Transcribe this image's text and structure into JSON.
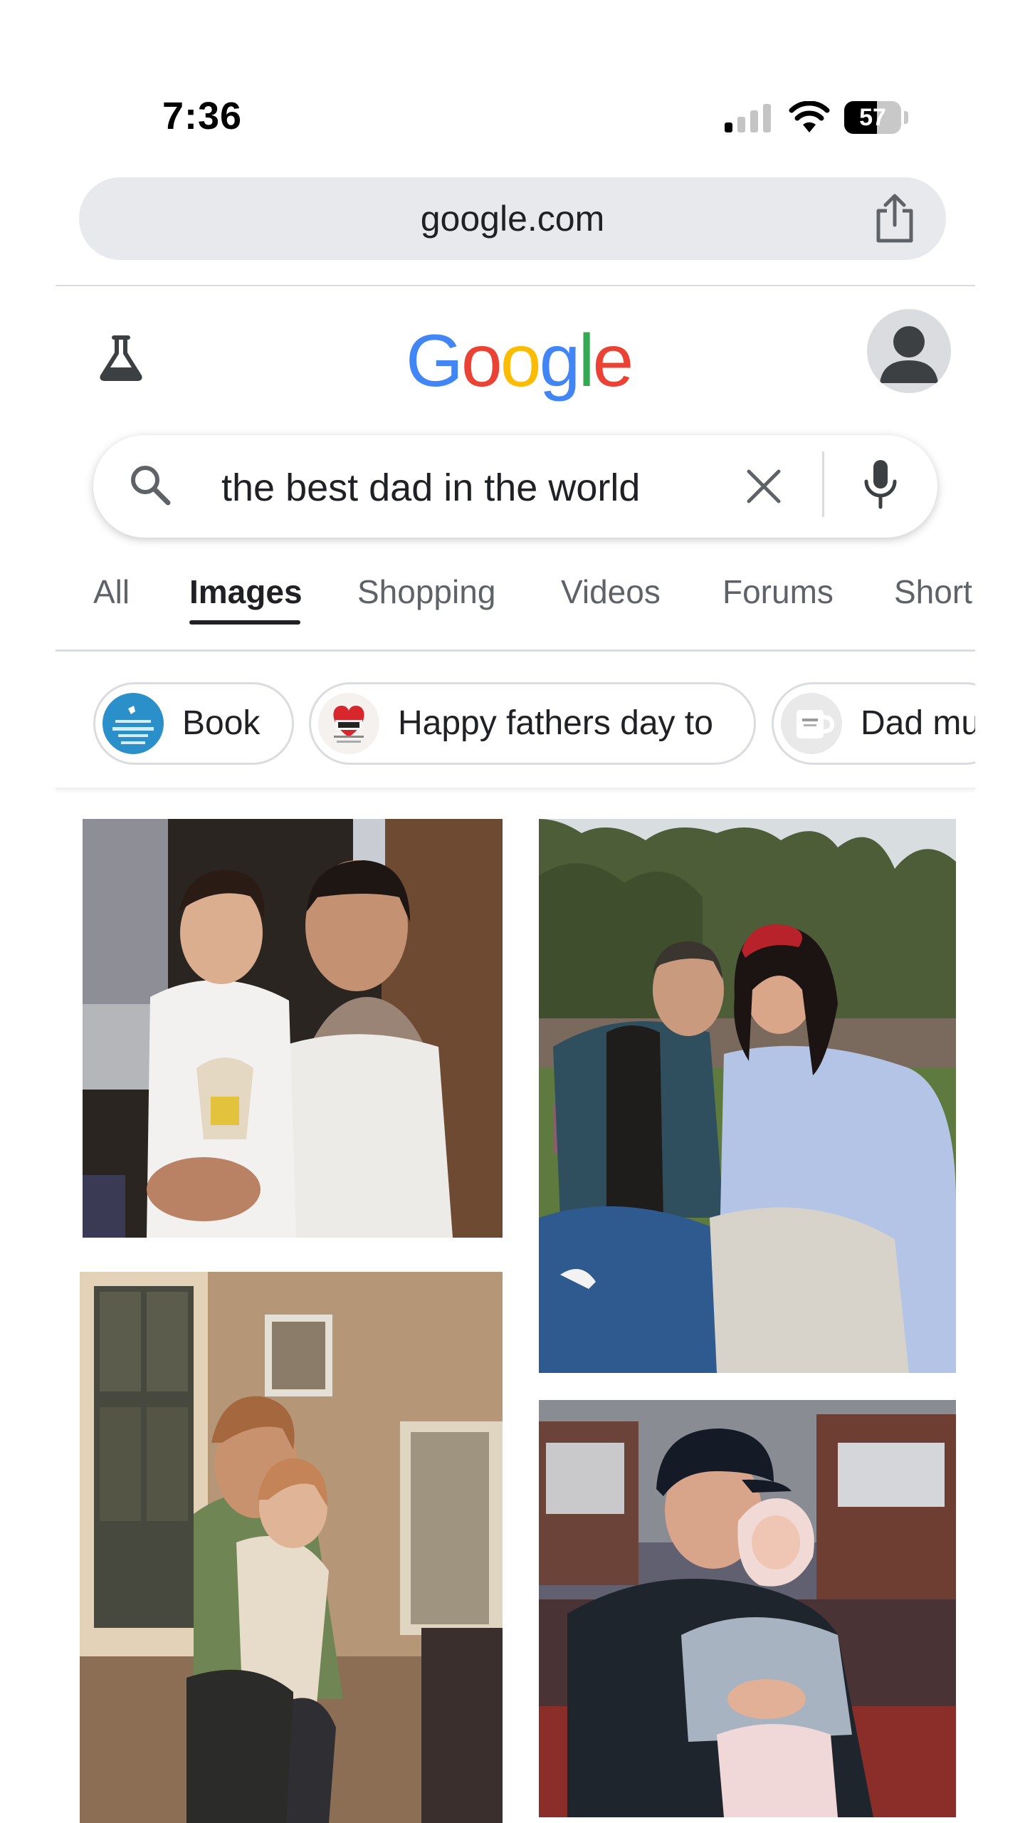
{
  "status_bar": {
    "time": "7:36",
    "battery_percent": "57",
    "battery_level": 0.57,
    "signal_bars": 1
  },
  "browser": {
    "url": "google.com"
  },
  "google": {
    "logo_letters": [
      {
        "char": "G",
        "color": "#4285F4"
      },
      {
        "char": "o",
        "color": "#EA4335"
      },
      {
        "char": "o",
        "color": "#FBBC05"
      },
      {
        "char": "g",
        "color": "#4285F4"
      },
      {
        "char": "l",
        "color": "#34A853"
      },
      {
        "char": "e",
        "color": "#EA4335"
      }
    ]
  },
  "search": {
    "query": "the best dad in the world"
  },
  "tabs": [
    {
      "label": "All"
    },
    {
      "label": "Images",
      "selected": true
    },
    {
      "label": "Shopping"
    },
    {
      "label": "Videos"
    },
    {
      "label": "Forums"
    },
    {
      "label": "Short"
    }
  ],
  "chips": [
    {
      "label": "Book"
    },
    {
      "label": "Happy fathers day to"
    },
    {
      "label": "Dad mu"
    }
  ],
  "results": [
    {
      "icon": "photo-father-daughter-sweater"
    },
    {
      "icon": "photo-father-daughter-park"
    },
    {
      "icon": "photo-father-child-hug"
    },
    {
      "icon": "photo-father-baby-yankees-cap"
    }
  ]
}
